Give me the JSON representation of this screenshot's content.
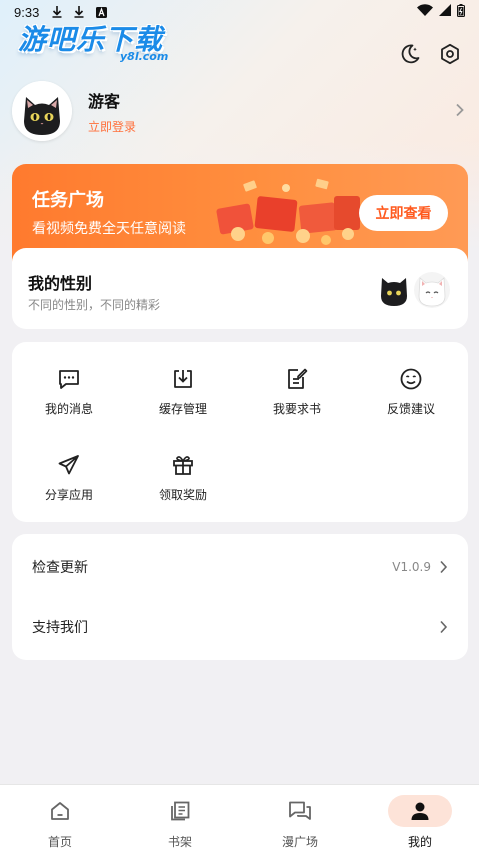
{
  "status_bar": {
    "time": "9:33"
  },
  "logo": {
    "main": "游吧乐下载",
    "sub": "y8l.com"
  },
  "profile": {
    "name": "游客",
    "login_link": "立即登录"
  },
  "task_card": {
    "title": "任务广场",
    "subtitle": "看视频免费全天任意阅读",
    "button": "立即查看"
  },
  "gender_card": {
    "title": "我的性别",
    "subtitle": "不同的性别，不同的精彩"
  },
  "menu": {
    "items": [
      {
        "label": "我的消息",
        "icon": "message-icon"
      },
      {
        "label": "缓存管理",
        "icon": "download-icon"
      },
      {
        "label": "我要求书",
        "icon": "request-book-icon"
      },
      {
        "label": "反馈建议",
        "icon": "feedback-smile-icon"
      },
      {
        "label": "分享应用",
        "icon": "share-icon"
      },
      {
        "label": "领取奖励",
        "icon": "gift-icon"
      }
    ]
  },
  "list": {
    "update": {
      "label": "检查更新",
      "value": "V1.0.9"
    },
    "support": {
      "label": "支持我们"
    }
  },
  "bottom_nav": {
    "items": [
      {
        "label": "首页",
        "icon": "home-icon"
      },
      {
        "label": "书架",
        "icon": "bookshelf-icon"
      },
      {
        "label": "漫广场",
        "icon": "comic-square-icon"
      },
      {
        "label": "我的",
        "icon": "profile-icon"
      }
    ],
    "active": "我的"
  },
  "colors": {
    "accent": "#ff7a2e",
    "login_link": "#ff6f3a",
    "logo": "#1b8be8",
    "active_nav_bg": "#fde3d8"
  }
}
